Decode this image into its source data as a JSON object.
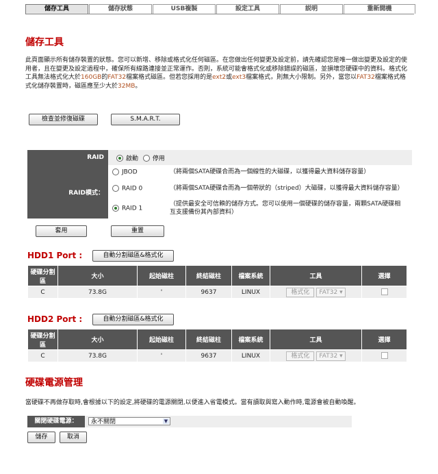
{
  "tabs": [
    {
      "label": "儲存工具",
      "active": true
    },
    {
      "label": "儲存狀態",
      "active": false
    },
    {
      "label": "USB複製",
      "active": false
    },
    {
      "label": "設定工具",
      "active": false
    },
    {
      "label": "説明",
      "active": false
    },
    {
      "label": "重新開機",
      "active": false
    }
  ],
  "page_title": "儲存工具",
  "intro": {
    "p1": "此頁面顯示所有儲存裝置的狀態。您可以新增、移除或格式化任何磁區。在您做出任何變更及設定前，請先確認您是唯一做出變更及設定的使用者，且在變更及設定過程中，確保所有線路連接並正常運作。否則，系統可能會格式化或移除錯誤的磁區，並損壞您硬碟中的資料。格式化工具無法格式化大於",
    "h1": "160GB",
    "p2": "的",
    "h2": "FAT32",
    "p3": "檔案格式磁區。但若您採用的是",
    "h3": "ext2",
    "p4": "或",
    "h4": "ext3",
    "p5": "檔案格式，則無大小限制。另外，當您以",
    "h5": "FAT32",
    "p6": "檔案格式格式化儲存裝置時，磁區應至少大於",
    "h6": "32MB",
    "p7": "。"
  },
  "tools": {
    "check_label": "檢查並修復磁碟",
    "smart_label": "S.M.A.R.T."
  },
  "raid": {
    "raid_label": "RAID",
    "enable_label": "啟動",
    "disable_label": "停用",
    "mode_label": "RAID模式：",
    "jbod_label": "JBOD",
    "jbod_desc": "（將兩個SATA硬碟合而為一個線性的大磁碟，以獲得最大資料儲存容量）",
    "raid0_label": "RAID 0",
    "raid0_desc": "（將兩個SATA硬碟合而為一個帶狀的（striped）大磁碟，以獲得最大資料儲存容量）",
    "raid1_label": "RAID 1",
    "raid1_desc": "（提供最安全可信賴的儲存方式。您可以使用一個硬碟的儲存容量，兩顆SATA硬碟相互支援備份其內部資料）",
    "apply_label": "套用",
    "reset_label": "重置"
  },
  "hdd_columns": [
    "硬碟分割區",
    "大小",
    "起始磁柱",
    "終結磁柱",
    "檔案系統",
    "工具",
    "選擇"
  ],
  "hdd1": {
    "title": "HDD1 Port :",
    "auto_label": "自動分割磁區&格式化",
    "row": {
      "partition": "C",
      "size": "73.8G",
      "start": "'",
      "end": "9637",
      "fs": "LINUX",
      "format_label": "格式化",
      "fs_option": "FAT32"
    }
  },
  "hdd2": {
    "title": "HDD2 Port :",
    "auto_label": "自動分割磁區&格式化",
    "row": {
      "partition": "C",
      "size": "73.8G",
      "start": "'",
      "end": "9637",
      "fs": "LINUX",
      "format_label": "格式化",
      "fs_option": "FAT32"
    }
  },
  "power": {
    "title": "硬碟電源管理",
    "desc": "當硬碟不再做存取時,會根據以下的設定,將硬碟的電源關閉,以便進入省電模式。當有讀取與寫入動作時,電源會被自動喚醒。",
    "off_label": "關閉硬碟電源：",
    "off_value": "永不關閉",
    "save_label": "儲存",
    "cancel_label": "取消"
  }
}
